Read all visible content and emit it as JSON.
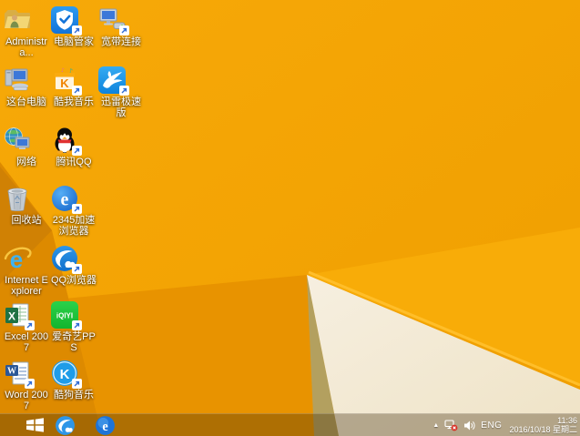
{
  "desktop": {
    "icons": [
      {
        "name": "administrator-folder",
        "label": "Administra..."
      },
      {
        "name": "pc-manager",
        "label": "电脑管家"
      },
      {
        "name": "broadband-connection",
        "label": "宽带连接"
      },
      {
        "name": "this-pc",
        "label": "这台电脑"
      },
      {
        "name": "kuwo-music",
        "label": "酷我音乐"
      },
      {
        "name": "thunder-speed",
        "label": "迅雷极速版"
      },
      {
        "name": "network",
        "label": "网络"
      },
      {
        "name": "tencent-qq",
        "label": "腾讯QQ"
      },
      {
        "name": "recycle-bin",
        "label": "回收站"
      },
      {
        "name": "2345-browser",
        "label": "2345加速浏览器"
      },
      {
        "name": "internet-explorer",
        "label": "Internet Explorer"
      },
      {
        "name": "qq-browser",
        "label": "QQ浏览器"
      },
      {
        "name": "excel-2007",
        "label": "Excel 2007"
      },
      {
        "name": "iqiyi-pps",
        "label": "爱奇艺PPS"
      },
      {
        "name": "word-2007",
        "label": "Word 2007"
      },
      {
        "name": "kugou-music",
        "label": "酷狗音乐"
      }
    ]
  },
  "taskbar": {
    "pinned": [
      "start",
      "qq-browser",
      "2345-browser"
    ],
    "tray": {
      "language": "ENG",
      "time": "11:36",
      "date": "2016/10/18 星期二"
    }
  },
  "colors": {
    "wallpaper_base": "#F4A306",
    "wallpaper_facet_dark": "#DD8A00",
    "wallpaper_facet_darker": "#D08104",
    "wallpaper_shadow_wedge": "#E89300",
    "wallpaper_khaki": "#B3A05F",
    "wallpaper_cream": "#F4EBD8",
    "wallpaper_ridge": "#FFBE2A",
    "taskbar_overlay": "rgba(62,42,8,0.34)"
  }
}
